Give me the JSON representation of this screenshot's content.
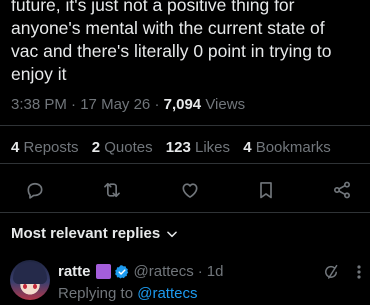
{
  "tweet": {
    "text": "future, it's just not a positive thing for\nanyone's mental with the current state of\nvac and there's literally 0 point in trying to\nenjoy it",
    "time": "3:38 PM",
    "date": "17 May 26",
    "separator": "·",
    "views_count": "7,094",
    "views_label": "Views"
  },
  "stats": {
    "reposts_count": "4",
    "reposts_label": "Reposts",
    "quotes_count": "2",
    "quotes_label": "Quotes",
    "likes_count": "123",
    "likes_label": "Likes",
    "bookmarks_count": "4",
    "bookmarks_label": "Bookmarks"
  },
  "actions": {
    "icons": [
      "reply-icon",
      "repost-icon",
      "like-icon",
      "bookmark-icon",
      "share-icon"
    ],
    "icon_color": "#71767b"
  },
  "replies": {
    "sort_label": "Most relevant replies"
  },
  "reply": {
    "name": "ratte",
    "emoji_color": "#a45edb",
    "verified_color": "#1d9bf0",
    "handle": "@rattecs",
    "separator": "·",
    "age": "1d",
    "replying_prefix": "Replying to",
    "replying_to": "@rattecs"
  },
  "colors": {
    "background": "#000000",
    "text": "#e7e9ea",
    "muted": "#71767b",
    "accent": "#1d9bf0",
    "divider": "#2f3336"
  }
}
